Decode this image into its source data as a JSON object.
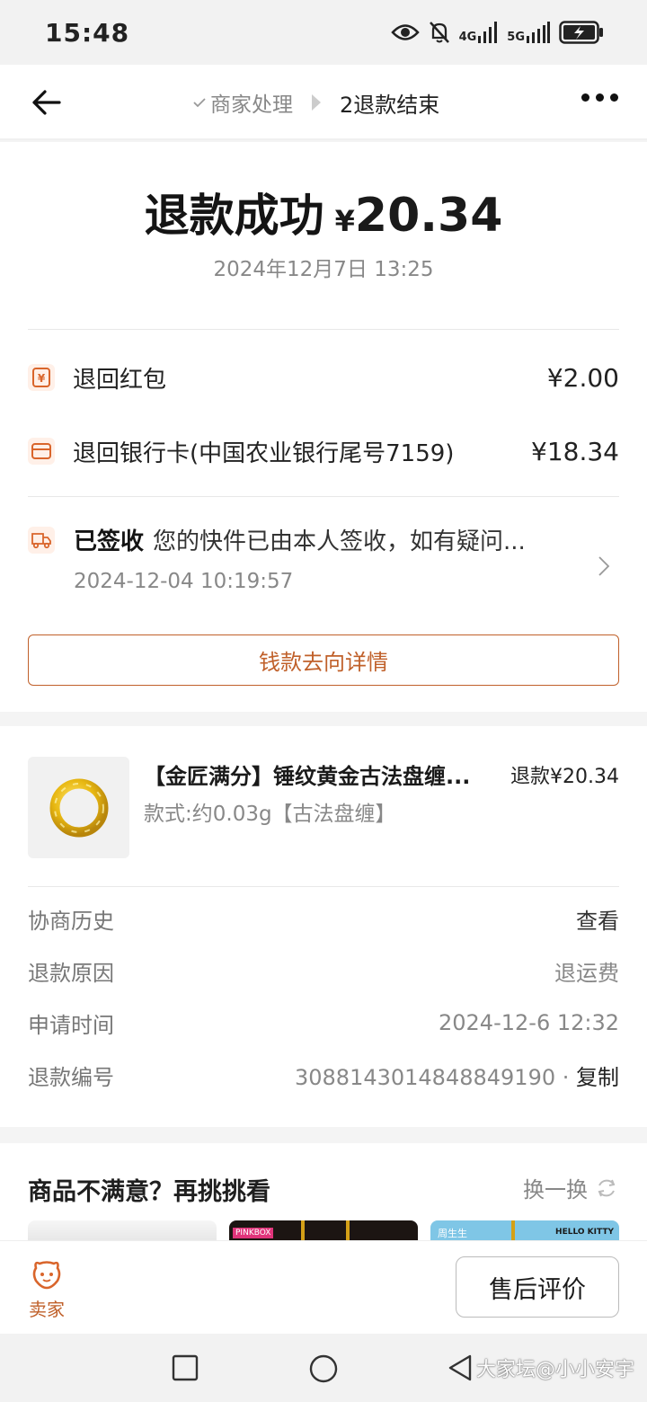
{
  "status_bar": {
    "time": "15:48",
    "net1": "4G",
    "net2": "5G"
  },
  "nav": {
    "step1_label": "商家处理",
    "step2_label": "2退款结束"
  },
  "summary": {
    "status": "退款成功",
    "currency": "¥",
    "amount": "20.34",
    "date": "2024年12月7日 13:25"
  },
  "refund_items": [
    {
      "icon": "red-packet-icon",
      "label": "退回红包",
      "value": "¥2.00"
    },
    {
      "icon": "bank-card-icon",
      "label": "退回银行卡(中国农业银行尾号7159)",
      "value": "¥18.34"
    }
  ],
  "logistics": {
    "status": "已签收",
    "message": "您的快件已由本人签收，如有疑问...",
    "time": "2024-12-04 10:19:57"
  },
  "money_flow_button": "钱款去向详情",
  "product": {
    "title": "【金匠满分】锤纹黄金古法盘缠...",
    "spec": "款式:约0.03g【古法盘缠】",
    "refund_label": "退款¥20.34"
  },
  "info_rows": [
    {
      "label": "协商历史",
      "value": "查看"
    },
    {
      "label": "退款原因",
      "value": "退运费"
    },
    {
      "label": "申请时间",
      "value": "2024-12-6 12:32"
    },
    {
      "label": "退款编号",
      "value": "3088143014848849190",
      "action": "复制"
    }
  ],
  "recommend": {
    "title": "商品不满意？再挑挑看",
    "refresh_label": "换一换",
    "thumb_tags": [
      "PINKBOX",
      "HELLO KITTY",
      "周生生"
    ]
  },
  "bottom": {
    "seller_label": "卖家",
    "review_button": "售后评价"
  },
  "watermark": "大家坛@小小安宇",
  "colors": {
    "accent": "#c0602a",
    "icon_bg": "#fff0e8"
  }
}
